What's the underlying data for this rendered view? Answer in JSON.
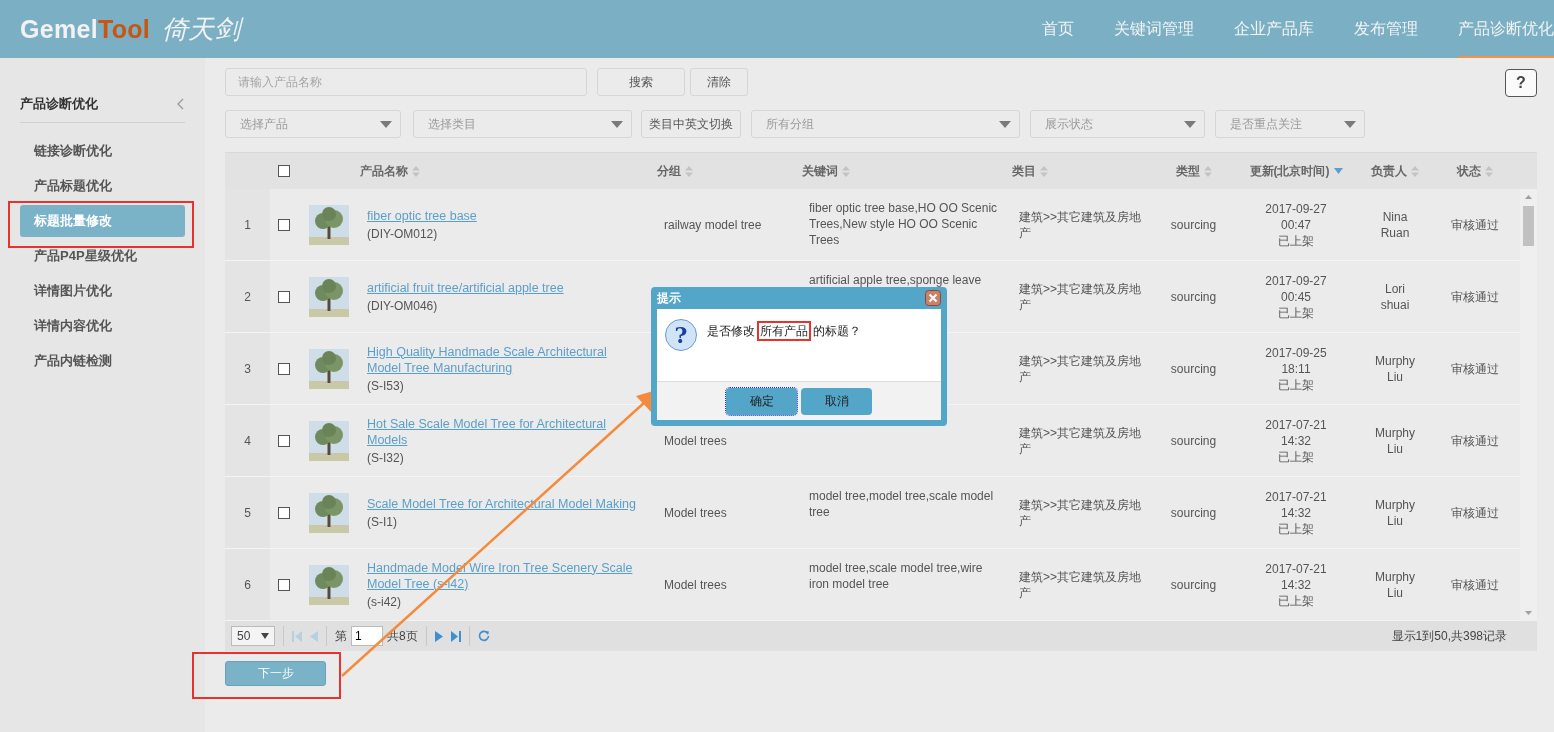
{
  "header": {
    "logo": {
      "part_1": "Gemel",
      "part_2": "Tool",
      "calligraphy": "倚天剑"
    },
    "nav": [
      {
        "label": "首页",
        "selected": false
      },
      {
        "label": "关键词管理",
        "selected": false
      },
      {
        "label": "企业产品库",
        "selected": false
      },
      {
        "label": "发布管理",
        "selected": false
      },
      {
        "label": "产品诊断优化",
        "selected": true
      }
    ]
  },
  "sidebar": {
    "title": "产品诊断优化",
    "items": [
      {
        "label": "链接诊断优化",
        "selected": false
      },
      {
        "label": "产品标题优化",
        "selected": false
      },
      {
        "label": "标题批量修改",
        "selected": true
      },
      {
        "label": "产品P4P星级优化",
        "selected": false
      },
      {
        "label": "详情图片优化",
        "selected": false
      },
      {
        "label": "详情内容优化",
        "selected": false
      },
      {
        "label": "产品内链检测",
        "selected": false
      }
    ]
  },
  "search": {
    "placeholder": "请输入产品名称",
    "buttons": [
      "搜索",
      "清除"
    ]
  },
  "help_button": "?",
  "filters": [
    {
      "kind": "select",
      "placeholder": "选择产品"
    },
    {
      "kind": "select",
      "placeholder": "选择类目"
    },
    {
      "kind": "button",
      "label": "类目中英文切换"
    },
    {
      "kind": "select",
      "placeholder": "所有分组"
    },
    {
      "kind": "select",
      "placeholder": "展示状态"
    },
    {
      "kind": "select",
      "placeholder": "是否重点关注"
    }
  ],
  "table": {
    "header_checkbox": {
      "checked": false
    },
    "columns": [
      {
        "label": "产品名称",
        "sorted_descending": false
      },
      {
        "label": "分组",
        "sorted_descending": false
      },
      {
        "label": "关键词",
        "sorted_descending": false
      },
      {
        "label": "类目",
        "sorted_descending": false
      },
      {
        "label": "类型",
        "sorted_descending": false
      },
      {
        "label": "更新(北京时间)",
        "sorted_descending": true
      },
      {
        "label": "负责人",
        "sorted_descending": false
      },
      {
        "label": "状态",
        "sorted_descending": false
      }
    ],
    "rows": [
      {
        "index": "1",
        "checked": false,
        "title": "fiber optic tree base",
        "code": "(DIY-OM012)",
        "group": "railway model tree",
        "keywords": "fiber optic tree base,HO OO Scenic Trees,New style HO OO Scenic Trees",
        "category": "建筑>>其它建筑及房地产",
        "type": "sourcing",
        "date": "2017-09-27",
        "time": "00:47",
        "listing": "已上架",
        "owner": "Nina Ruan",
        "review": "审核通过"
      },
      {
        "index": "2",
        "checked": false,
        "title": "artificial fruit tree/artificial apple tree",
        "code": "(DIY-OM046)",
        "keywords": "artificial apple tree,sponge leave",
        "category": "建筑>>其它建筑及房地产",
        "type": "sourcing",
        "date": "2017-09-27",
        "time": "00:45",
        "listing": "已上架",
        "owner": "Lori shuai",
        "review": "审核通过"
      },
      {
        "index": "3",
        "checked": false,
        "title": "High Quality Handmade Scale Architectural Model Tree Manufacturing",
        "code": "(S-I53)",
        "category": "建筑>>其它建筑及房地产",
        "type": "sourcing",
        "date": "2017-09-25",
        "time": "18:11",
        "listing": "已上架",
        "owner": "Murphy Liu",
        "review": "审核通过"
      },
      {
        "index": "4",
        "checked": false,
        "title": "Hot Sale Scale Model Tree for Architectural Models",
        "code": "(S-I32)",
        "group": "Model trees",
        "category": "建筑>>其它建筑及房地产",
        "type": "sourcing",
        "date": "2017-07-21",
        "time": "14:32",
        "listing": "已上架",
        "owner": "Murphy Liu",
        "review": "审核通过"
      },
      {
        "index": "5",
        "checked": false,
        "title": "Scale Model Tree for Architectural Model Making",
        "code": "(S-I1)",
        "group": "Model trees",
        "keywords": "model tree,model tree,scale model tree",
        "category": "建筑>>其它建筑及房地产",
        "type": "sourcing",
        "date": "2017-07-21",
        "time": "14:32",
        "listing": "已上架",
        "owner": "Murphy Liu",
        "review": "审核通过"
      },
      {
        "index": "6",
        "checked": false,
        "title": "Handmade Model Wire Iron Tree Scenery Scale Model Tree (s-i42)",
        "code": "(s-i42)",
        "group": "Model trees",
        "keywords": "model tree,scale model tree,wire iron model tree",
        "category": "建筑>>其它建筑及房地产",
        "type": "sourcing",
        "date": "2017-07-21",
        "time": "14:32",
        "listing": "已上架",
        "owner": "Murphy Liu",
        "review": "审核通过"
      }
    ]
  },
  "pager": {
    "page_size": "50",
    "page_label": "第",
    "page": "1",
    "total_pages": "共8页",
    "summary": "显示1到50,共398记录"
  },
  "next_button": "下一步",
  "dialog": {
    "title": "提示",
    "icon_glyph": "?",
    "message": {
      "before": "是否修改",
      "highlighted": "所有产品",
      "after": "的标题？"
    },
    "buttons": [
      {
        "label": "确定",
        "focused": true
      },
      {
        "label": "取消",
        "focused": false
      }
    ]
  }
}
